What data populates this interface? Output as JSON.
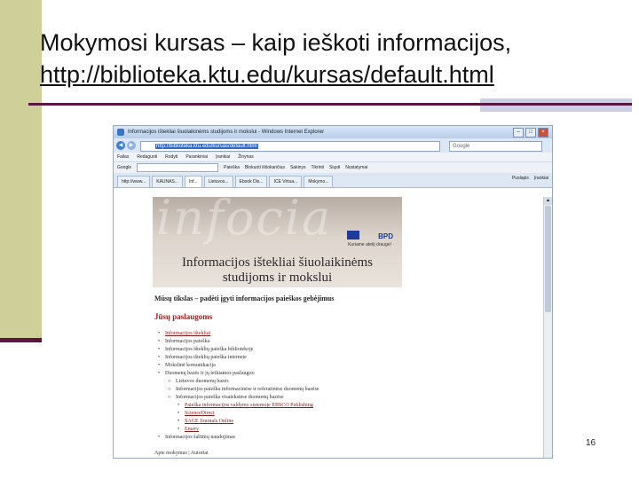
{
  "slide": {
    "title_line1": "Mokymosi kursas – kaip ieškoti informacijos,",
    "title_line2": "http://biblioteka.ktu.edu/kursas/default.html",
    "page_number": "16"
  },
  "browser": {
    "window_title": "Informacijos ištekliai šiuolaikinėms studijoms ir mokslui - Windows Internet Explorer",
    "url": "http://biblioteka.ktu.edu/kursas/default.html",
    "search_placeholder": "Google",
    "menu": [
      "Failas",
      "Redaguoti",
      "Rodyti",
      "Parankiniai",
      "Įrankiai",
      "Žinynas"
    ],
    "toolbar": {
      "google_label": "Google",
      "items": [
        "Paieška",
        "Blokuoti iššokančius",
        "Sakinys",
        "Tikrinti",
        "Siųsti",
        "Nustatymai"
      ]
    },
    "tabs": [
      "http://www...",
      "KAUNAS...",
      "Inf...",
      "Lietuvos...",
      "Ebook Dis...",
      "ICE Virtua...",
      "Mokymo..."
    ],
    "tab_commands": [
      "Puslapis",
      "Įrankiai"
    ]
  },
  "page": {
    "banner_ghost": "infocia",
    "logo_text": "BPD",
    "logo_sub": "Kuriame ateitį drauge!",
    "banner_headline_1": "Informacijos ištekliai šiuolaikinėms",
    "banner_headline_2": "studijoms ir mokslui",
    "motto": "Mūsų tikslas – padėti įgyti informacijos paieškos gebėjimus",
    "section_heading": "Jūsų paslaugoms",
    "list": [
      {
        "level": 1,
        "text": "Informacijos ištekliai",
        "link": true
      },
      {
        "level": 1,
        "text": "Informacijos paieška",
        "link": false
      },
      {
        "level": 1,
        "text": "Informacijos išteklių paieška bibliotekoje",
        "link": false
      },
      {
        "level": 1,
        "text": "Informacijos išteklių paieška internete",
        "link": false
      },
      {
        "level": 1,
        "text": "Mokslinė komunikacija",
        "link": false
      },
      {
        "level": 1,
        "text": "Duomenų bazės ir jų teikiamos paslaugos:",
        "link": false
      },
      {
        "level": 2,
        "text": "Lietuvos duomenų bazės",
        "link": false
      },
      {
        "level": 2,
        "text": "Informacijos paieška informacinėse ir referatinėse duomenų bazėse",
        "link": false
      },
      {
        "level": 2,
        "text": "Informacijos paieška visatekstėse duomenų bazėse",
        "link": false
      },
      {
        "level": 3,
        "text": "Paieška informacijos valdymo sistemoje EBSCO Publishing",
        "link": true
      },
      {
        "level": 3,
        "text": "ScienceDirect",
        "link": true
      },
      {
        "level": 3,
        "text": "SAGE Journals Online",
        "link": true
      },
      {
        "level": 3,
        "text": "Emery",
        "link": true
      },
      {
        "level": 1,
        "text": "Informacijos šaltinių naudojimas",
        "link": false
      }
    ],
    "footer": "Apie mokymus | Autoriai"
  }
}
